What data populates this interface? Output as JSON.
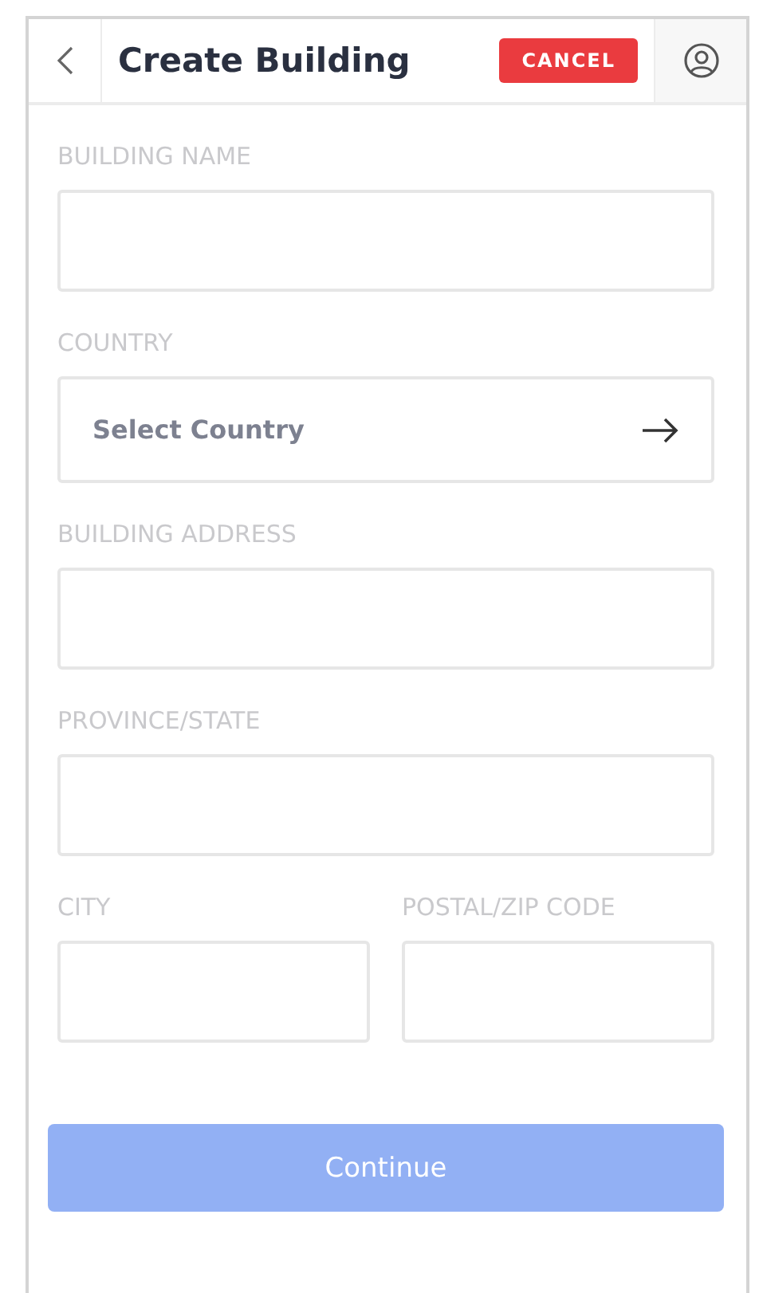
{
  "header": {
    "title": "Create Building",
    "cancel": "CANCEL"
  },
  "fields": [
    {
      "label": "BUILDING NAME",
      "kind": "text"
    },
    {
      "label": "COUNTRY",
      "kind": "select",
      "value": "Select Country"
    },
    {
      "label": "BUILDING ADDRESS",
      "kind": "text"
    },
    {
      "label": "PROVINCE/STATE",
      "kind": "text"
    }
  ],
  "pair": [
    {
      "label": "CITY",
      "kind": "text"
    },
    {
      "label": "POSTAL/ZIP CODE",
      "kind": "text"
    }
  ],
  "continue": {
    "label": "Continue",
    "disabled": true
  }
}
